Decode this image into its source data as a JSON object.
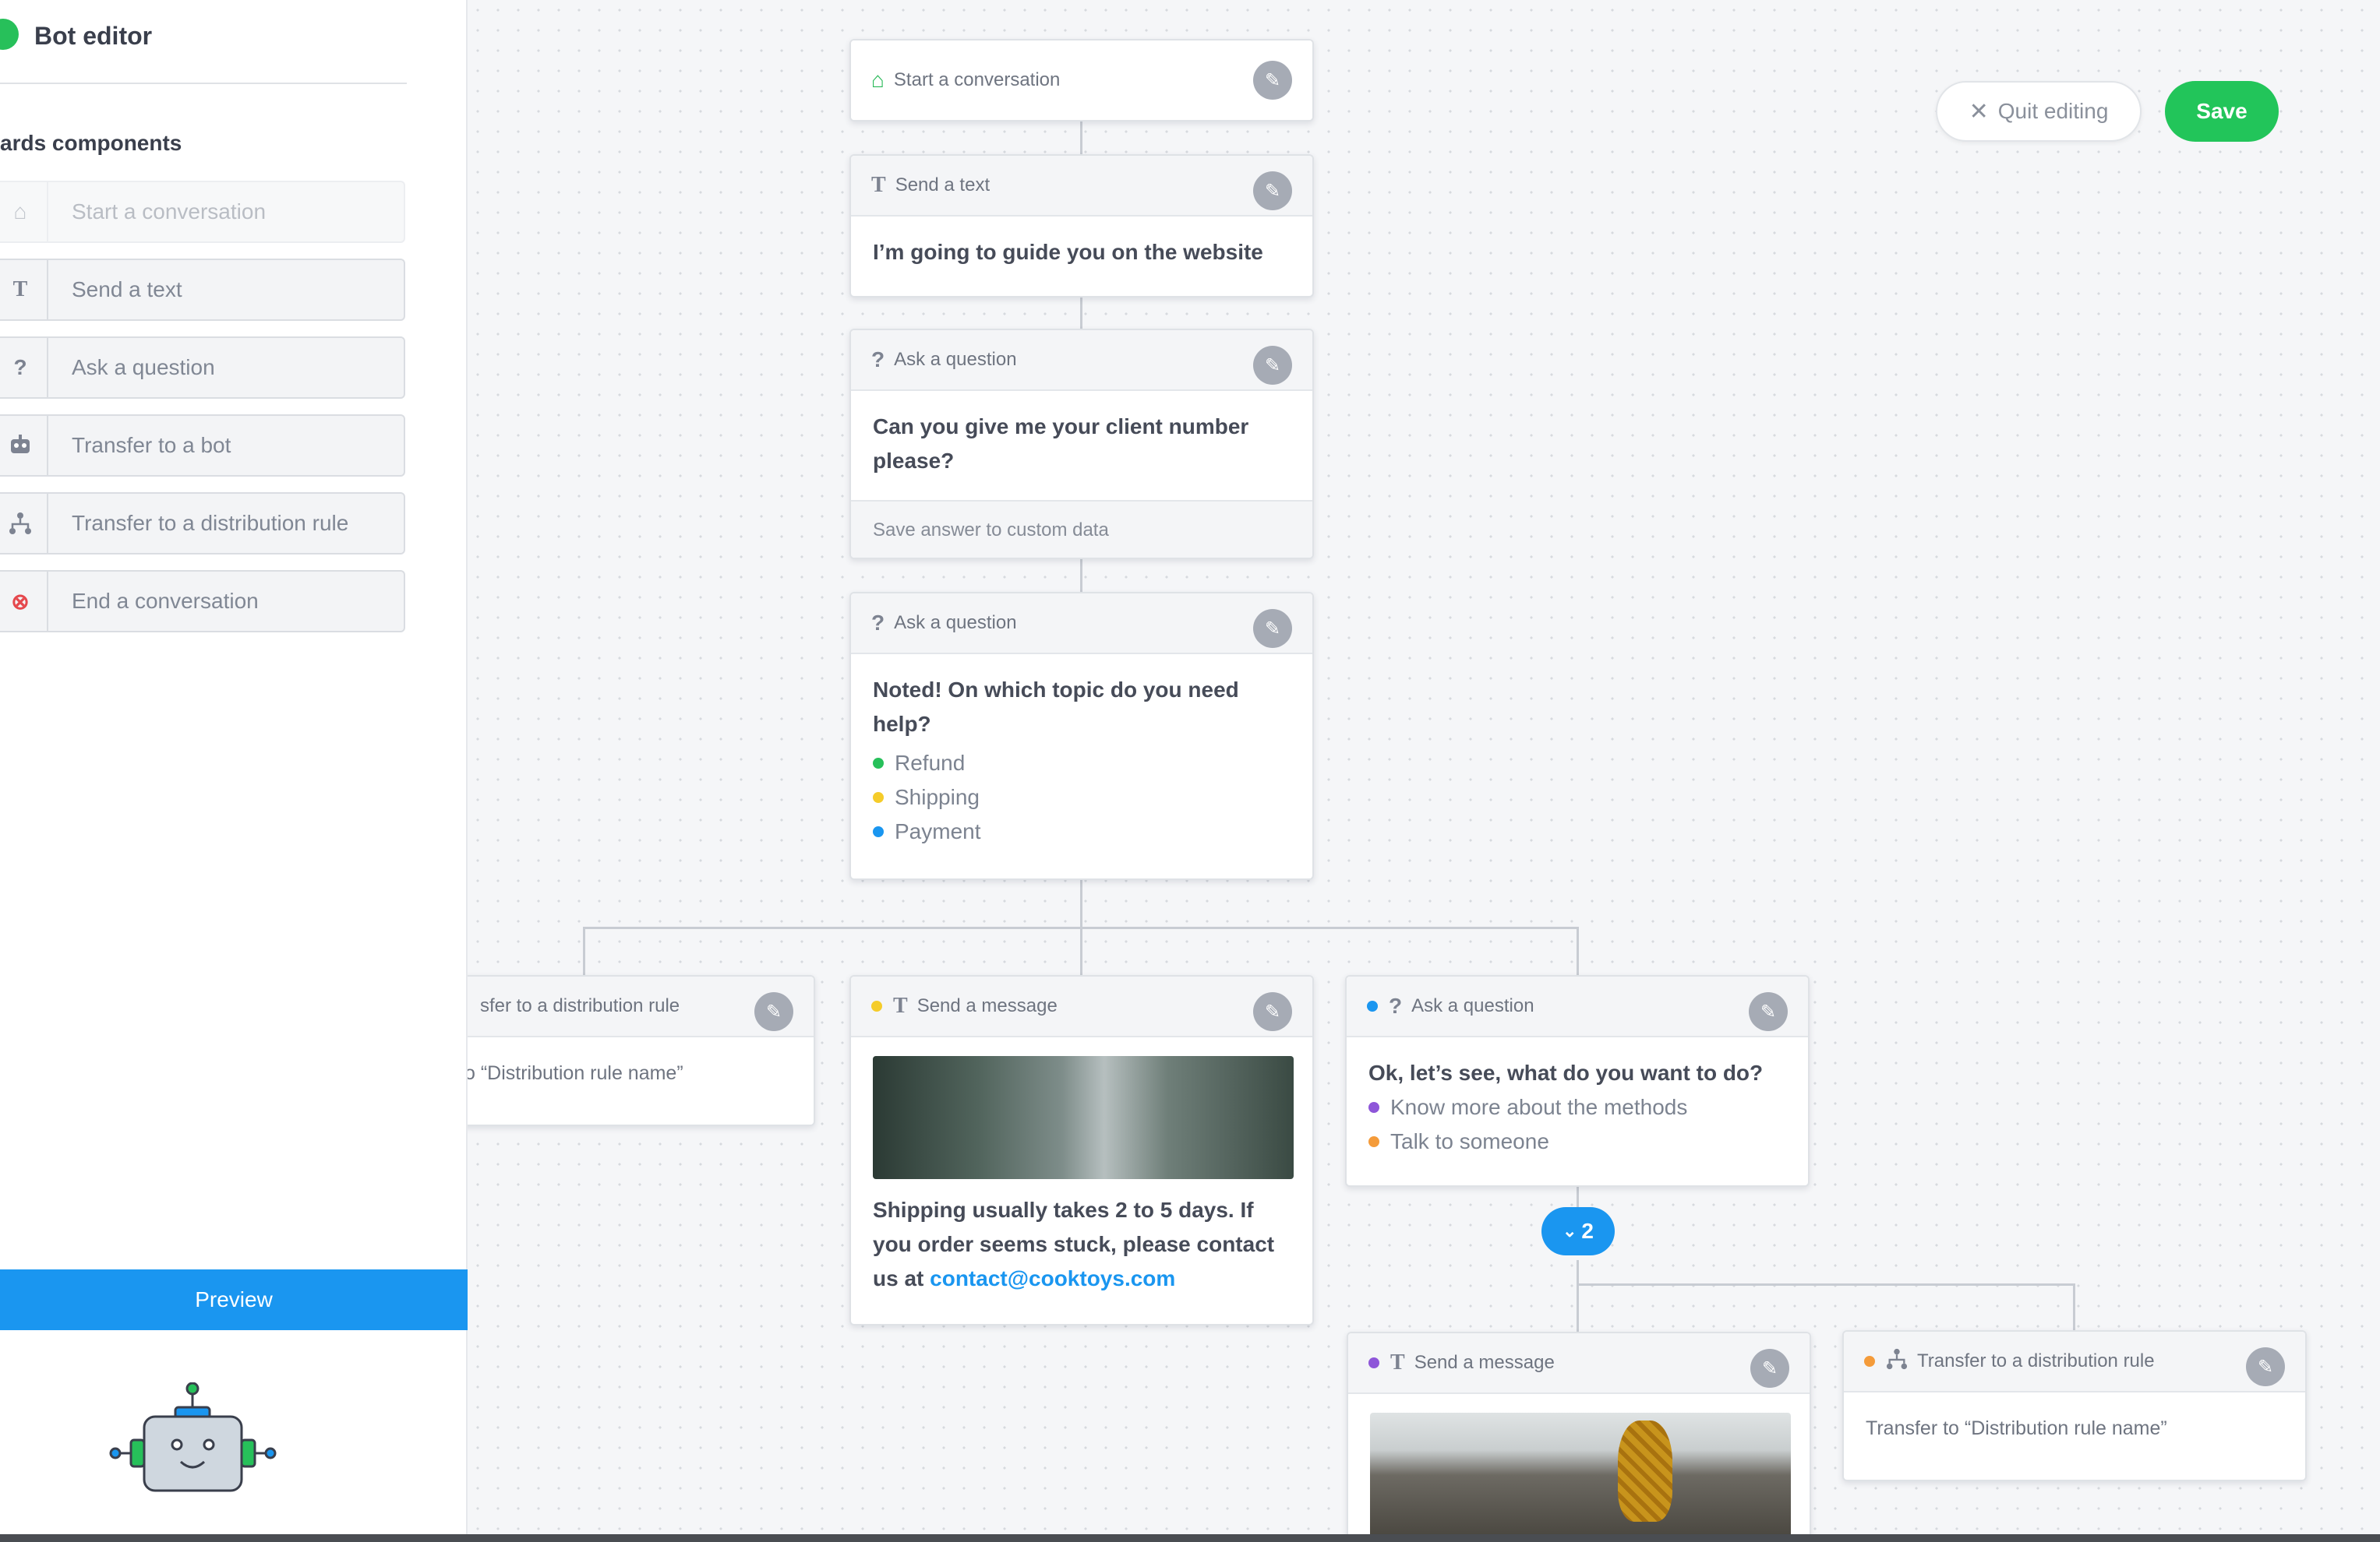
{
  "sidebar": {
    "title": "Bot editor",
    "section_label": "ards components",
    "components": [
      {
        "label": "Start a conversation",
        "icon": "home-icon"
      },
      {
        "label": "Send a text",
        "icon": "text-icon"
      },
      {
        "label": "Ask a question",
        "icon": "question-icon"
      },
      {
        "label": "Transfer to a bot",
        "icon": "robot-icon"
      },
      {
        "label": "Transfer to a distribution rule",
        "icon": "distribution-icon"
      },
      {
        "label": "End a conversation",
        "icon": "close-circle-icon"
      }
    ],
    "preview_label": "Preview"
  },
  "toolbar": {
    "quit_label": "Quit editing",
    "save_label": "Save"
  },
  "colors": {
    "accent_blue": "#1a96f0",
    "save_green": "#22c55a",
    "refund_green": "#27c05a",
    "shipping_yellow": "#f5cc2a",
    "payment_blue": "#1a96f0",
    "purple": "#8e56d9",
    "orange": "#f49b3a"
  },
  "cards": {
    "start": {
      "title": "Start a conversation"
    },
    "text1": {
      "title": "Send a text",
      "body": "I’m going to guide you on the website"
    },
    "q1": {
      "title": "Ask a question",
      "body": "Can you give me your client number please?",
      "footer": "Save answer to custom data"
    },
    "q2": {
      "title": "Ask a question",
      "body": "Noted! On which topic do you need help?",
      "options": [
        "Refund",
        "Shipping",
        "Payment"
      ]
    },
    "dist_left": {
      "title": "sfer to a distribution rule",
      "body": "o “Distribution rule name”"
    },
    "msg_shipping": {
      "title": "Send a message",
      "body": "Shipping usually takes 2 to 5 days. If you order seems stuck, please contact us at",
      "link": "contact@cooktoys.com"
    },
    "q3": {
      "title": "Ask a question",
      "body": "Ok, let’s see, what do you want to do?",
      "options": [
        "Know more about the methods",
        "Talk to someone"
      ]
    },
    "collapse_badge": "2",
    "msg_methods": {
      "title": "Send a message"
    },
    "dist_right": {
      "title": "Transfer to a distribution rule",
      "body": "Transfer to “Distribution rule name”"
    }
  }
}
